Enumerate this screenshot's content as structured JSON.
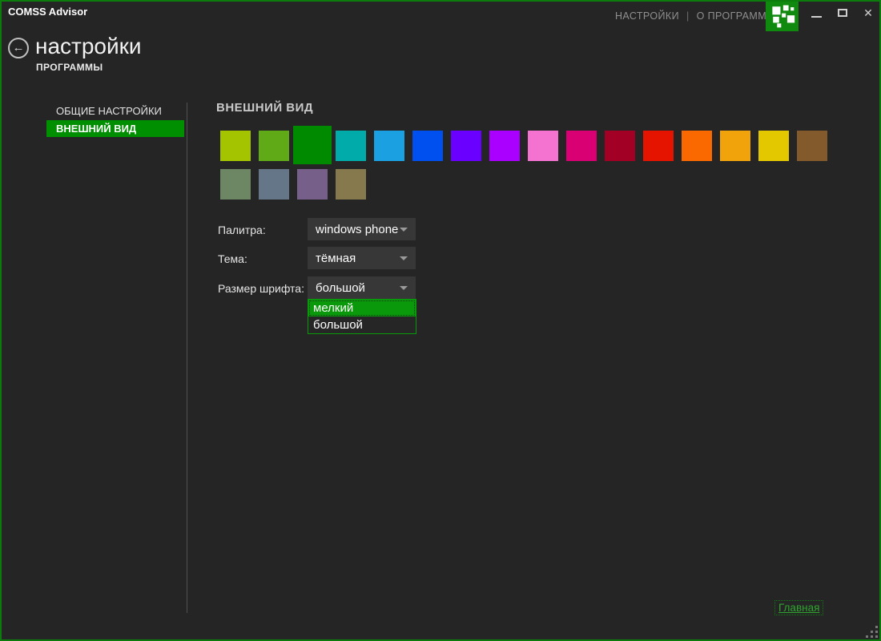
{
  "window": {
    "title": "COMSS Advisor",
    "menu": [
      "НАСТРОЙКИ",
      "О ПРОГРАММЕ"
    ],
    "menu_separator": "|"
  },
  "header": {
    "title": "настройки",
    "subtitle": "ПРОГРАММЫ"
  },
  "sidebar": {
    "items": [
      {
        "label": "ОБЩИЕ НАСТРОЙКИ",
        "selected": false
      },
      {
        "label": "ВНЕШНИЙ ВИД",
        "selected": true
      }
    ]
  },
  "main": {
    "section_title": "ВНЕШНИЙ ВИД",
    "palette": {
      "selected_index": 2,
      "row1": [
        {
          "name": "lime",
          "hex": "#A4C400"
        },
        {
          "name": "green",
          "hex": "#60A917"
        },
        {
          "name": "emerald",
          "hex": "#008A00"
        },
        {
          "name": "teal",
          "hex": "#00ABA9"
        },
        {
          "name": "cyan",
          "hex": "#1BA1E2"
        },
        {
          "name": "cobalt",
          "hex": "#0050EF"
        },
        {
          "name": "indigo",
          "hex": "#6A00FF"
        },
        {
          "name": "violet",
          "hex": "#AA00FF"
        },
        {
          "name": "pink",
          "hex": "#F472D0"
        },
        {
          "name": "magenta",
          "hex": "#D80073"
        },
        {
          "name": "crimson",
          "hex": "#A20025"
        },
        {
          "name": "red",
          "hex": "#E51400"
        },
        {
          "name": "orange",
          "hex": "#FA6800"
        },
        {
          "name": "amber",
          "hex": "#F0A30A"
        },
        {
          "name": "yellow",
          "hex": "#E3C800"
        },
        {
          "name": "brown",
          "hex": "#825A2C"
        }
      ],
      "row2": [
        {
          "name": "olive",
          "hex": "#6D8764"
        },
        {
          "name": "steel",
          "hex": "#647687"
        },
        {
          "name": "mauve",
          "hex": "#76608A"
        },
        {
          "name": "taupe",
          "hex": "#87794E"
        }
      ]
    },
    "fields": [
      {
        "label": "Палитра:",
        "value": "windows phone"
      },
      {
        "label": "Тема:",
        "value": "тёмная"
      },
      {
        "label": "Размер шрифта:",
        "value": "большой"
      }
    ],
    "font_size_options": [
      {
        "label": "мелкий",
        "highlighted": true
      },
      {
        "label": "большой",
        "highlighted": false
      }
    ]
  },
  "footer": {
    "home_link": "Главная"
  },
  "colors": {
    "accent_green": "#008f00",
    "list_highlight": "#0a990a",
    "window_border": "#0c7d0c",
    "link_green": "#2fa52f",
    "background": "#252525"
  }
}
